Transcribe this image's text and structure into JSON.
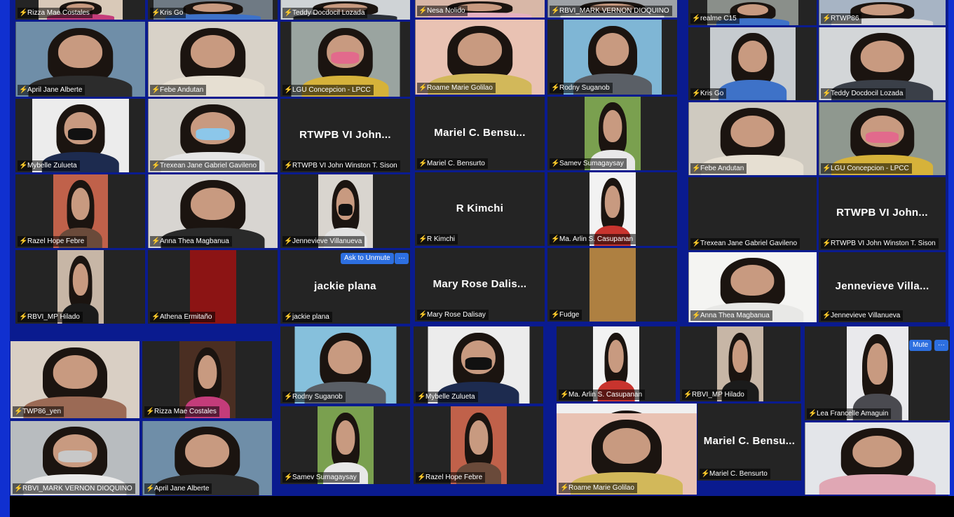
{
  "buttons": {
    "ask_to_unmute": "Ask to Unmute",
    "more": "···",
    "mute": "Mute"
  },
  "tiles": [
    {
      "id": "t1",
      "name": "Rizza Mae Costales",
      "video": true,
      "bg": "#d9c9b8",
      "shirt": "#c43c7a"
    },
    {
      "id": "t2",
      "name": "Kris Go",
      "video": true,
      "bg": "#6f7a84",
      "shirt": "#3e72c8"
    },
    {
      "id": "t3",
      "name": "Teddy Docdocil Lozada",
      "video": true,
      "bg": "#cfd3d6",
      "shirt": "#2a2f38"
    },
    {
      "id": "t4",
      "name": "Nesa Nolido",
      "video": true,
      "bg": "#d8b7a7",
      "shirt": "#e5b0c0"
    },
    {
      "id": "t5",
      "name": "RBVI_MARK VERNON DIOQUINO",
      "video": true,
      "bg": "#9ea2a6",
      "shirt": "#eaeaea"
    },
    {
      "id": "t6",
      "name": "realme C15",
      "video": true,
      "bg": "#8a8f8a",
      "shirt": "#3e72c8"
    },
    {
      "id": "t7",
      "name": "RTWP86",
      "video": true,
      "bg": "#a7b4c4",
      "shirt": "#d7d7d7"
    },
    {
      "id": "t8",
      "name": "April Jane Alberte",
      "video": true,
      "bg": "#6f8ea8",
      "shirt": "#2c2c2c"
    },
    {
      "id": "t9",
      "name": "Febe Andutan",
      "video": true,
      "bg": "#d8d2c8",
      "shirt": "#e6dfd2"
    },
    {
      "id": "t10",
      "name": "LGU Concepcion - LPCC",
      "video": true,
      "bg": "#9aa4a0",
      "shirt": "#d6b23a",
      "mask": "#e26a8c"
    },
    {
      "id": "t11",
      "name": "Roame Marie Golilao",
      "video": true,
      "bg": "#e9c2b3",
      "shirt": "#d2b85a"
    },
    {
      "id": "t12",
      "name": "Rodny Suganob",
      "video": true,
      "bg": "#7fb6d5",
      "shirt": "#5a5f66"
    },
    {
      "id": "t13",
      "name": "Kris Go",
      "video": true,
      "bg": "#c6cbcf",
      "shirt": "#3e72c8"
    },
    {
      "id": "t14",
      "name": "Teddy Docdocil Lozada",
      "video": true,
      "bg": "#d3d6d8",
      "shirt": "#3a3f48"
    },
    {
      "id": "t15",
      "name": "Mybelle Zulueta",
      "video": true,
      "bg": "#ececec",
      "shirt": "#1d2b4f",
      "mask": "#111111"
    },
    {
      "id": "t16",
      "name": "Trexean Jane Gabriel Gavileno",
      "video": true,
      "bg": "#d2cfc8",
      "shirt": "#e5e5e5",
      "mask": "#8cc7ea"
    },
    {
      "id": "t17",
      "name": "RTWPB VI John Winston T. Sison",
      "video": false,
      "label": "RTWPB VI John..."
    },
    {
      "id": "t18",
      "name": "Mariel C. Bensurto",
      "video": false,
      "label": "Mariel C. Bensu..."
    },
    {
      "id": "t19",
      "name": "Samev Sumagaysay",
      "video": true,
      "bg": "#7aa04f",
      "shirt": "#e8e8e8"
    },
    {
      "id": "t20",
      "name": "Febe Andutan",
      "video": true,
      "bg": "#cfcac0",
      "shirt": "#e6dfd2"
    },
    {
      "id": "t21",
      "name": "LGU Concepcion - LPCC",
      "video": true,
      "bg": "#8f988f",
      "shirt": "#d6b23a",
      "mask": "#e26a8c"
    },
    {
      "id": "t22",
      "name": "Razel Hope Febre",
      "video": true,
      "bg": "#c0614a",
      "shirt": "#6a4a3a"
    },
    {
      "id": "t23",
      "name": "Anna Thea Magbanua",
      "video": true,
      "bg": "#d8d5d1",
      "shirt": "#2a2a2a"
    },
    {
      "id": "t24",
      "name": "Jennevieve Villanueva",
      "video": true,
      "bg": "#d9d5cf",
      "shirt": "#e2e2e2",
      "mask": "#111111"
    },
    {
      "id": "t25",
      "name": "R Kimchi",
      "video": false,
      "label": "R Kimchi"
    },
    {
      "id": "t26",
      "name": "Ma. Arlin S. Casupanan",
      "video": true,
      "bg": "#f2f2f2",
      "shirt": "#c8342e"
    },
    {
      "id": "t27",
      "name": "Trexean Jane Gabriel Gavileno",
      "video": false,
      "label": ""
    },
    {
      "id": "t28",
      "name": "RTWPB VI John Winston T. Sison",
      "video": false,
      "label": "RTWPB VI John..."
    },
    {
      "id": "t29",
      "name": "RBVI_MP Hilado",
      "video": true,
      "bg": "#c7b6a6",
      "shirt": "#1b1b1b"
    },
    {
      "id": "t30",
      "name": "Athena Ermitaño",
      "video": true,
      "bg": "#8c1414",
      "shirt": "#8c1414",
      "plain": true
    },
    {
      "id": "t31",
      "name": "jackie plana",
      "video": false,
      "label": "jackie plana"
    },
    {
      "id": "t32",
      "name": "Mary Rose Dalisay",
      "video": false,
      "label": "Mary Rose Dalis..."
    },
    {
      "id": "t33",
      "name": "Fudge",
      "video": true,
      "bg": "#5a4a38",
      "shirt": "#e6a547",
      "plain": true
    },
    {
      "id": "t34",
      "name": "Anna Thea Magbanua",
      "video": true,
      "bg": "#f4f4f2",
      "shirt": "#e8e8e6"
    },
    {
      "id": "t35",
      "name": "Jennevieve Villanueva",
      "video": false,
      "label": "Jennevieve Villa..."
    },
    {
      "id": "b1",
      "name": "TWP86_yen",
      "video": true,
      "bg": "#d9cfc4",
      "shirt": "#9b6a55"
    },
    {
      "id": "b2",
      "name": "Rizza Mae Costales",
      "video": true,
      "bg": "#4a2e22",
      "shirt": "#c43c7a"
    },
    {
      "id": "b3",
      "name": "Rodny Suganob",
      "video": true,
      "bg": "#86c0dc",
      "shirt": "#5a5f66"
    },
    {
      "id": "b4",
      "name": "Mybelle Zulueta",
      "video": true,
      "bg": "#ececec",
      "shirt": "#1d2b4f",
      "mask": "#111111"
    },
    {
      "id": "b5",
      "name": "Ma. Arlin S. Casupanan",
      "video": true,
      "bg": "#f2f2f2",
      "shirt": "#c8342e"
    },
    {
      "id": "b6",
      "name": "RBVI_MP Hilado",
      "video": true,
      "bg": "#c7b6a6",
      "shirt": "#1b1b1b"
    },
    {
      "id": "b7",
      "name": "Lea Francelle Amaguin",
      "video": true,
      "bg": "#e9e9ec",
      "shirt": "#4a4a50"
    },
    {
      "id": "b8",
      "name": "RBVI_MARK VERNON DIOQUINO",
      "video": true,
      "bg": "#b8bcbf",
      "shirt": "#eaeaea",
      "mask": "#c8c8c8"
    },
    {
      "id": "b9",
      "name": "April Jane Alberte",
      "video": true,
      "bg": "#6f8ea8",
      "shirt": "#2c2c2c"
    },
    {
      "id": "b10",
      "name": "Samev Sumagaysay",
      "video": true,
      "bg": "#7aa04f",
      "shirt": "#e8e8e8"
    },
    {
      "id": "b11",
      "name": "Razel Hope Febre",
      "video": true,
      "bg": "#c0614a",
      "shirt": "#6a4a3a"
    },
    {
      "id": "b12",
      "name": "Nesa Nolido",
      "video": true,
      "bg": "#f0f0f0",
      "shirt": "#e5b0c0"
    },
    {
      "id": "b13",
      "name": "Roame Marie Golilao",
      "video": true,
      "bg": "#e9c2b3",
      "shirt": "#d2b85a"
    },
    {
      "id": "b14",
      "name": "Mariel C. Bensurto",
      "video": false,
      "label": "Mariel C. Bensu..."
    },
    {
      "id": "b15",
      "name": "",
      "video": true,
      "bg": "#e3e5e9",
      "shirt": "#e0a7b4"
    }
  ]
}
